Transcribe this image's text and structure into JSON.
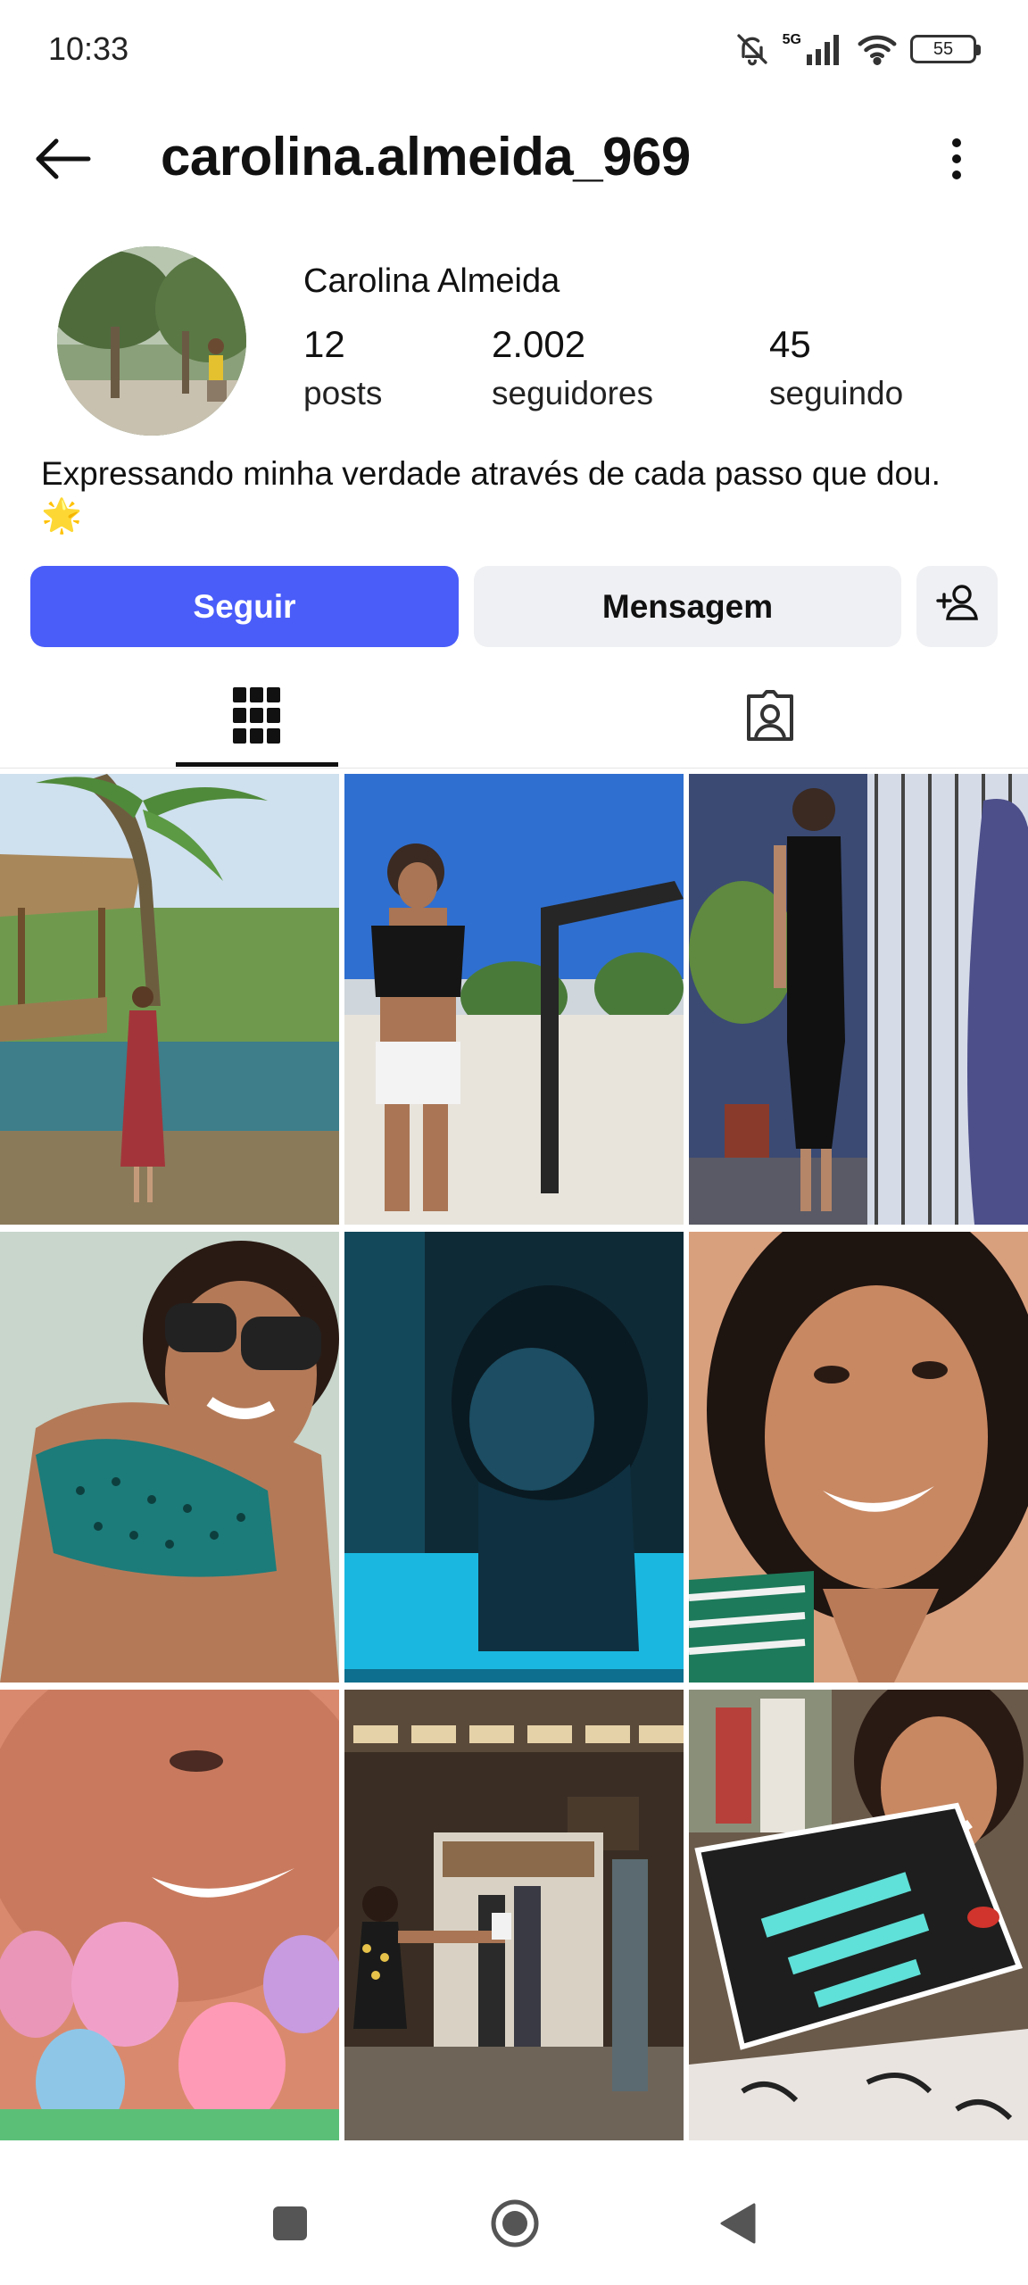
{
  "status_bar": {
    "time": "10:33",
    "network": "5G",
    "battery": "55"
  },
  "header": {
    "username": "carolina.almeida_969"
  },
  "profile": {
    "full_name": "Carolina Almeida",
    "posts_count": "12",
    "posts_label": "posts",
    "followers_count": "2.002",
    "followers_label": "seguidores",
    "following_count": "45",
    "following_label": "seguindo",
    "bio": "Expressando minha verdade através de cada passo que dou. 🌟"
  },
  "actions": {
    "follow_label": "Seguir",
    "message_label": "Mensagem"
  },
  "colors": {
    "accent": "#4a5df9",
    "secondary_button": "#eff0f3"
  },
  "icons": {
    "back": "arrow-left-icon",
    "more": "more-vertical-icon",
    "suggest": "person-add-icon",
    "grid_tab": "grid-icon",
    "tagged_tab": "tagged-person-icon"
  }
}
